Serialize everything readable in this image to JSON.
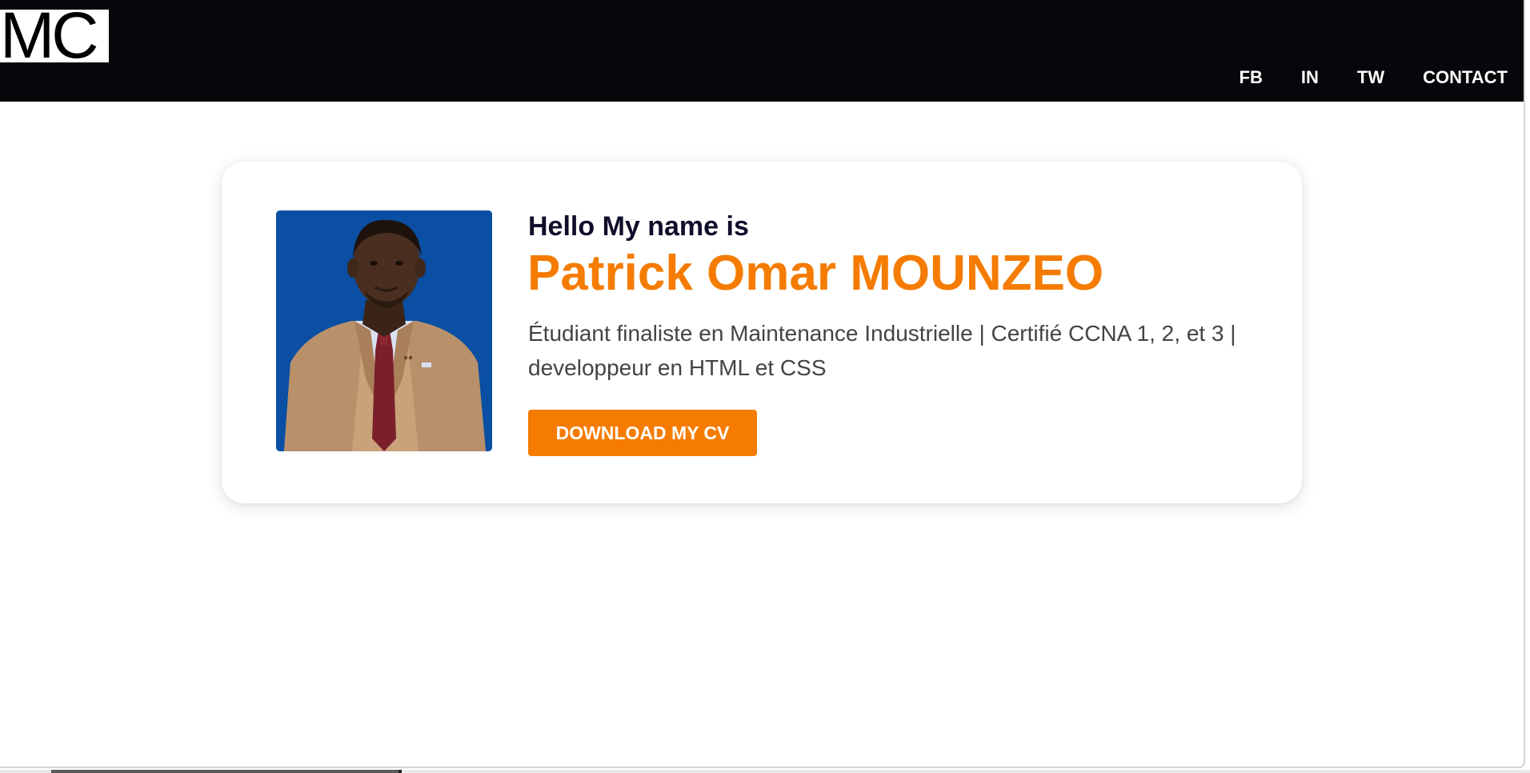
{
  "header": {
    "logo_text": "MC",
    "nav": [
      {
        "label": "FB"
      },
      {
        "label": "IN"
      },
      {
        "label": "TW"
      },
      {
        "label": "CONTACT"
      }
    ]
  },
  "hero": {
    "greeting": "Hello My name is",
    "name": "Patrick Omar MOUNZEO",
    "description": "Étudiant finaliste en Maintenance Industrielle | Certifié CCNA 1, 2, et 3 | developpeur en HTML et CSS",
    "cta_label": "DOWNLOAD MY CV",
    "photo_icon": "profile-photo"
  },
  "colors": {
    "accent": "#f57c00",
    "navbar": "#07070b",
    "photo_background": "#0a4fa3"
  }
}
